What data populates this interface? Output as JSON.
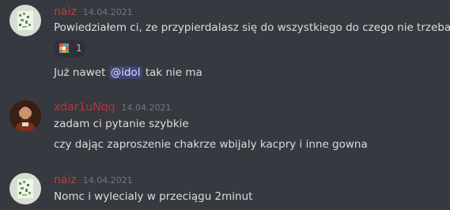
{
  "messages": [
    {
      "author": "naiz",
      "author_color": "#c23b3b",
      "timestamp": "14.04.2021",
      "lines": [
        "Powiedziałem ci, ze przypierdalasz się do wszystkiego do czego nie trzeba."
      ],
      "reaction": {
        "emoji_icon": "pixel-gif-emoji",
        "count": "1"
      },
      "followup": {
        "prefix": "Już nawet ",
        "mention": "@idol",
        "suffix": " tak nie ma"
      }
    },
    {
      "author": "xdar1uNqq",
      "author_color": "#b3363c",
      "timestamp": "14.04.2021",
      "lines": [
        "zadam ci pytanie szybkie",
        "czy dając zaproszenie chakrze wbijaly kacpry i inne gowna"
      ]
    },
    {
      "author": "naiz",
      "author_color": "#c23b3b",
      "timestamp": "14.04.2021",
      "lines": [
        "Nomc i wylecialy w przeciągu 2minut"
      ]
    }
  ],
  "colors": {
    "background": "#36393f",
    "text": "#dcddde",
    "timestamp": "#72767d",
    "mention_bg": "#4a5193",
    "reaction_bg": "#2f3136"
  }
}
